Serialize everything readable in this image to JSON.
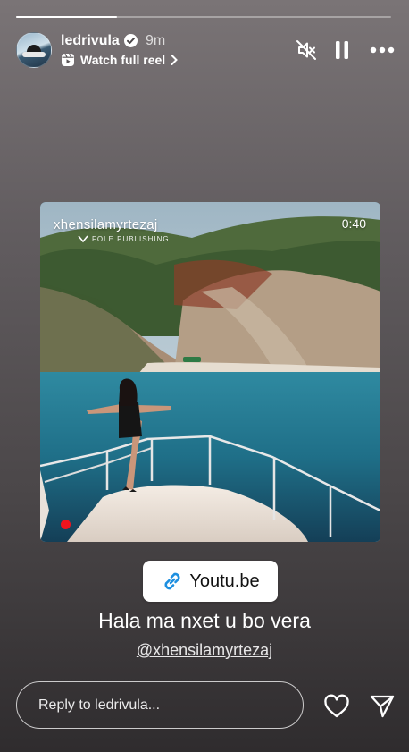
{
  "story": {
    "progress": 0.27,
    "username": "ledrivula",
    "time_ago": "9m",
    "watch_reel_label": "Watch full reel"
  },
  "controls": {
    "mute_icon": "speaker-muted-icon",
    "pause_icon": "pause-icon",
    "more_icon": "more-dots-icon"
  },
  "media": {
    "watermark_name": "xhensilamyrtezaj",
    "watermark_sub": "FOLE PUBLISHING",
    "duration": "0:40"
  },
  "sticker": {
    "link_label": "Youtu.be",
    "link_icon": "link-icon"
  },
  "caption": {
    "text": "Hala ma nxet u bo vera",
    "mention": "@xhensilamyrtezaj"
  },
  "reply": {
    "placeholder": "Reply to ledrivula..."
  },
  "colors": {
    "link_icon": "#1d8fe0",
    "record_dot": "#f0141e"
  }
}
